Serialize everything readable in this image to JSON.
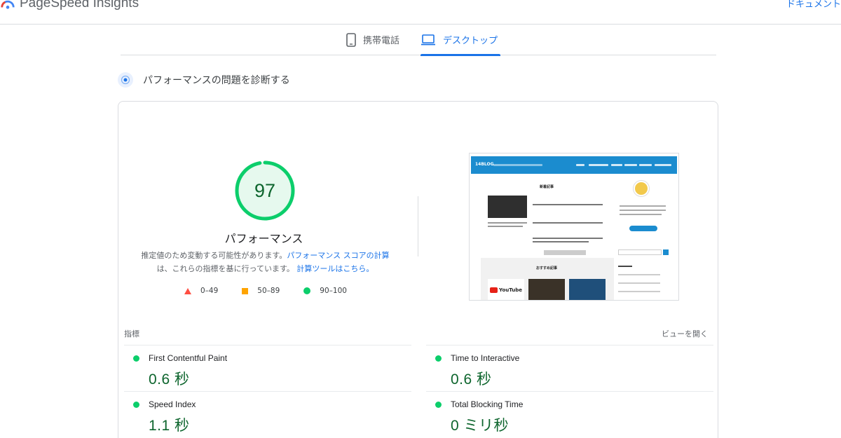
{
  "header": {
    "app_title": "PageSpeed Insights",
    "docs_link": "ドキュメント"
  },
  "tabs": [
    {
      "label": "携帯電話",
      "icon": "smartphone-icon",
      "selected": false
    },
    {
      "label": "デスクトップ",
      "icon": "laptop-icon",
      "selected": true
    }
  ],
  "section": {
    "title": "パフォーマンスの問題を診断する",
    "icon": "diagnostics-icon"
  },
  "performance": {
    "score": "97",
    "score_value": 97,
    "label": "パフォーマンス",
    "note_text_1": "推定値のため変動する可能性があります。",
    "note_link_1": "パフォーマンス スコアの計算",
    "note_text_2": "は、これらの指標を基に行っています。",
    "note_link_2": "計算ツールはこちら。",
    "legend": [
      {
        "range": "0–49",
        "shape": "triangle",
        "color": "#ff4e42"
      },
      {
        "range": "50–89",
        "shape": "square",
        "color": "#ffa400"
      },
      {
        "range": "90–100",
        "shape": "circle",
        "color": "#0cce6b"
      }
    ],
    "colors": {
      "pass": "#0cce6b",
      "pass_text": "#0d652d",
      "pass_bg": "#e6f9ee"
    }
  },
  "metrics": {
    "heading": "指標",
    "view_toggle": "ビューを開く",
    "items": [
      {
        "name": "First Contentful Paint",
        "value": "0.6 秒"
      },
      {
        "name": "Time to Interactive",
        "value": "0.6 秒"
      },
      {
        "name": "Speed Index",
        "value": "1.1 秒"
      },
      {
        "name": "Total Blocking Time",
        "value": "0 ミリ秒"
      }
    ]
  },
  "screenshot": {
    "site_name": "14BLOG",
    "heading_new": "新着記事",
    "heading_recommended": "おすすめ記事",
    "badge_text": "YouTube"
  }
}
